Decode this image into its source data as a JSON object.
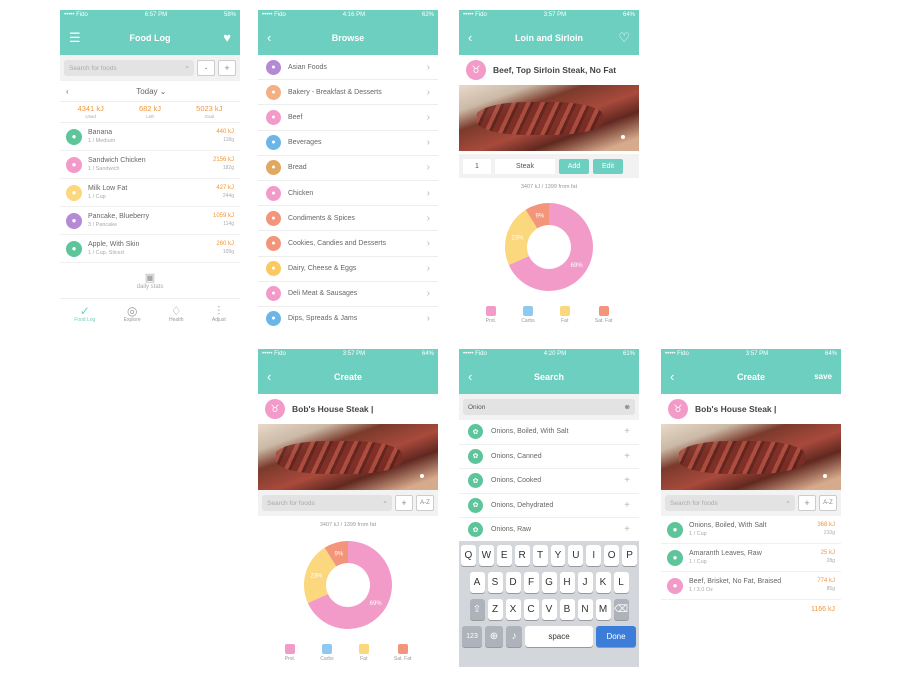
{
  "colors": {
    "teal": "#6ccfc0",
    "orange": "#f0963c",
    "pink": "#f29bc9",
    "blue": "#8ec9ef",
    "yellow": "#fbd77e",
    "salmon": "#f2957b"
  },
  "p1": {
    "status": {
      "carrier": "••••• Fido",
      "time": "6:57 PM",
      "battery": "58%"
    },
    "title": "Food Log",
    "search_placeholder": "Search for foods",
    "minus": "-",
    "plus": "+",
    "date": "Today",
    "summary": [
      {
        "value": "4341 kJ",
        "label": "Used"
      },
      {
        "value": "682 kJ",
        "label": "Left"
      },
      {
        "value": "5023 kJ",
        "label": "Goal"
      }
    ],
    "foods": [
      {
        "name": "Banana",
        "sub": "1 / Medium",
        "kj": "440 kJ",
        "g": "118g",
        "color": "#5ec49a"
      },
      {
        "name": "Sandwich Chicken",
        "sub": "1 / Sandwich",
        "kj": "2156 kJ",
        "g": "182g",
        "color": "#f29bc9"
      },
      {
        "name": "Milk Low Fat",
        "sub": "1 / Cup",
        "kj": "427 kJ",
        "g": "244g",
        "color": "#fbd77e"
      },
      {
        "name": "Pancake, Blueberry",
        "sub": "3 / Pancake",
        "kj": "1059 kJ",
        "g": "114g",
        "color": "#b48ad6"
      },
      {
        "name": "Apple, With Skin",
        "sub": "1 / Cup, Sliced",
        "kj": "260 kJ",
        "g": "109g",
        "color": "#5ec49a"
      }
    ],
    "daily_stats": "daily stats",
    "tabs": [
      "Food Log",
      "Explore",
      "Health",
      "Adjust"
    ]
  },
  "p2": {
    "status": {
      "carrier": "••••• Fido",
      "time": "4:16 PM",
      "battery": "62%"
    },
    "title": "Browse",
    "categories": [
      {
        "label": "Asian Foods",
        "color": "#b48ad6"
      },
      {
        "label": "Bakery - Breakfast & Desserts",
        "color": "#f4b083"
      },
      {
        "label": "Beef",
        "color": "#f29bc9"
      },
      {
        "label": "Beverages",
        "color": "#6cb5e8"
      },
      {
        "label": "Bread",
        "color": "#e0a860"
      },
      {
        "label": "Chicken",
        "color": "#f29bc9"
      },
      {
        "label": "Condiments & Spices",
        "color": "#f2957b"
      },
      {
        "label": "Cookies, Candies and Desserts",
        "color": "#f2957b"
      },
      {
        "label": "Dairy, Cheese & Eggs",
        "color": "#fbc95e"
      },
      {
        "label": "Deli Meat & Sausages",
        "color": "#f29bc9"
      },
      {
        "label": "Dips, Spreads & Jams",
        "color": "#6cb5e8"
      }
    ]
  },
  "p3": {
    "status": {
      "carrier": "••••• Fido",
      "time": "3:57 PM",
      "battery": "64%"
    },
    "title": "Loin and Sirloin",
    "food_title": "Beef, Top Sirloin Steak, No Fat",
    "qty": "1",
    "unit": "Steak",
    "add": "Add",
    "edit": "Edit",
    "kj_line": "3407 kJ / 1399 from fat"
  },
  "p4": {
    "status": {
      "carrier": "••••• Fido",
      "time": "3:57 PM",
      "battery": "64%"
    },
    "title": "Create",
    "food_title": "Bob's House Steak",
    "search_placeholder": "Search for foods",
    "plus": "+",
    "az": "A-Z",
    "kj_line": "3407 kJ / 1399 from fat"
  },
  "p5": {
    "status": {
      "carrier": "••••• Fido",
      "time": "4:20 PM",
      "battery": "61%"
    },
    "title": "Search",
    "query": "Onion",
    "results": [
      "Onions, Boiled, With Salt",
      "Onions, Canned",
      "Onions, Cooked",
      "Onions, Dehydrated",
      "Onions, Raw"
    ],
    "keys_row1": [
      "Q",
      "W",
      "E",
      "R",
      "T",
      "Y",
      "U",
      "I",
      "O",
      "P"
    ],
    "keys_row2": [
      "A",
      "S",
      "D",
      "F",
      "G",
      "H",
      "J",
      "K",
      "L"
    ],
    "keys_row3": [
      "Z",
      "X",
      "C",
      "V",
      "B",
      "N",
      "M"
    ],
    "k_123": "123",
    "k_space": "space",
    "k_done": "Done"
  },
  "p6": {
    "status": {
      "carrier": "••••• Fido",
      "time": "3:57 PM",
      "battery": "64%"
    },
    "title": "Create",
    "save": "save",
    "food_title": "Bob's House Steak",
    "search_placeholder": "Search for foods",
    "plus": "+",
    "az": "A-Z",
    "items": [
      {
        "name": "Onions, Boiled, With Salt",
        "sub": "1 / Cup",
        "kj": "368 kJ",
        "g": "210g",
        "color": "#5ec49a"
      },
      {
        "name": "Amaranth Leaves, Raw",
        "sub": "1 / Cup",
        "kj": "25 kJ",
        "g": "28g",
        "color": "#5ec49a"
      },
      {
        "name": "Beef, Brisket, No Fat, Braised",
        "sub": "1 / 3.0 Oz",
        "kj": "774 kJ",
        "g": "85g",
        "color": "#f29bc9"
      }
    ],
    "total": "1166 kJ"
  },
  "chart_data": {
    "type": "pie",
    "categories": [
      "Prot.",
      "Carbs",
      "Fat",
      "Sat. Fat"
    ],
    "values": [
      69,
      0,
      23,
      9
    ],
    "colors": [
      "#f29bc9",
      "#8ec9ef",
      "#fbd77e",
      "#f2957b"
    ],
    "data_labels": [
      "69%",
      "",
      "23%",
      "9%"
    ]
  }
}
